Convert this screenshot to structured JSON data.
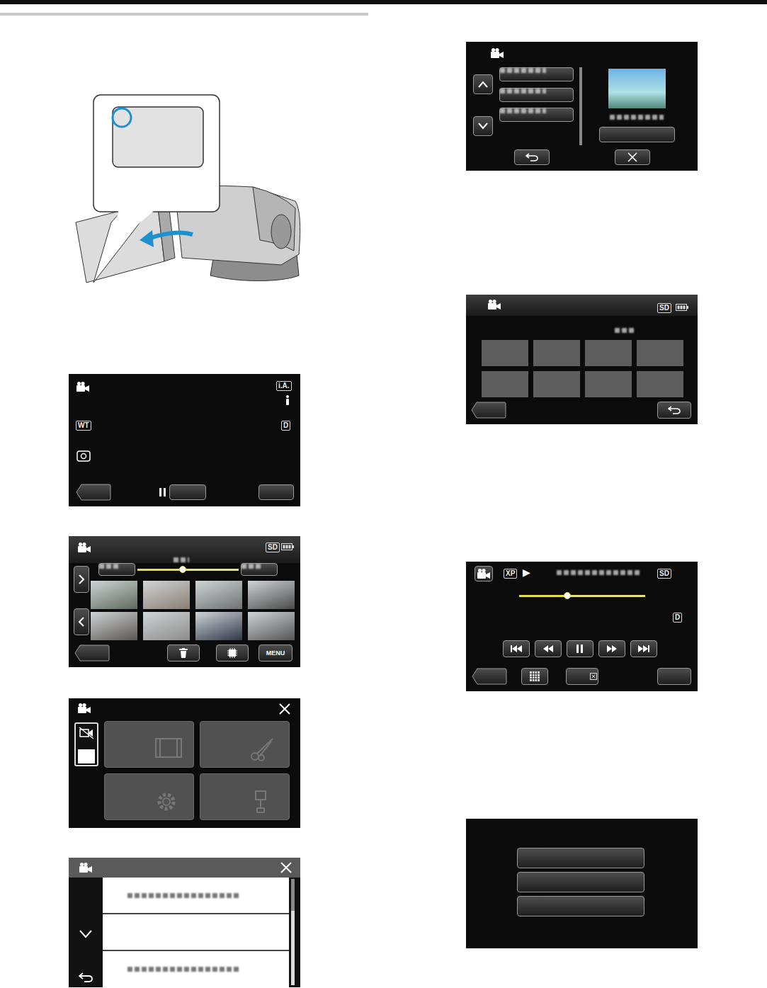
{
  "recording_screen": {
    "mode_badge": "i.A.",
    "wide_tele": "WT",
    "quality": "D"
  },
  "index_screen": {
    "media": "SD",
    "button": "MENU",
    "timeline_level": 0.45
  },
  "date_screen": {
    "media": "SD"
  },
  "playback_screen": {
    "quality_badge": "XP",
    "play_symbol": "▶",
    "media": "SD",
    "position_level": 0.38,
    "quality": "D"
  }
}
